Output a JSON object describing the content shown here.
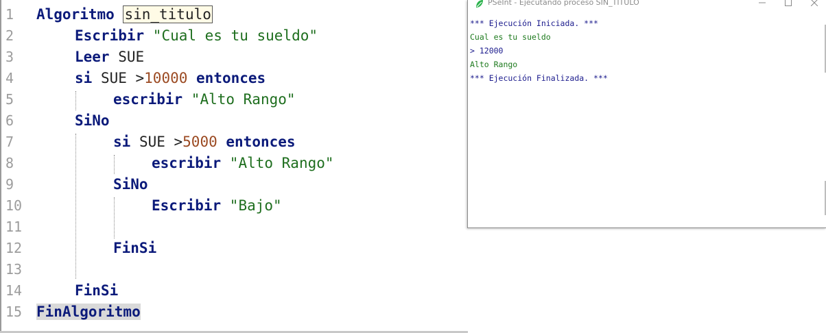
{
  "editor": {
    "lines": [
      {
        "num": "1",
        "tokens": [
          {
            "t": "Algoritmo",
            "c": "kw"
          },
          {
            "t": " ",
            "c": "idf"
          },
          {
            "t": "sin_titulo",
            "c": "box"
          }
        ]
      },
      {
        "num": "2",
        "tokens": [
          {
            "t": "Escribir",
            "c": "kw"
          },
          {
            "t": " \"Cual es tu sueldo\"",
            "c": "str"
          }
        ]
      },
      {
        "num": "3",
        "tokens": [
          {
            "t": "Leer",
            "c": "kw"
          },
          {
            "t": " SUE",
            "c": "idf"
          }
        ]
      },
      {
        "num": "4",
        "tokens": [
          {
            "t": "si",
            "c": "kw"
          },
          {
            "t": " SUE >",
            "c": "idf"
          },
          {
            "t": "10000",
            "c": "num"
          },
          {
            "t": " ",
            "c": "idf"
          },
          {
            "t": "entonces",
            "c": "kw"
          }
        ]
      },
      {
        "num": "5",
        "tokens": [
          {
            "t": "escribir",
            "c": "kw"
          },
          {
            "t": " \"Alto Rango\"",
            "c": "str"
          }
        ]
      },
      {
        "num": "6",
        "tokens": [
          {
            "t": "SiNo",
            "c": "kw"
          }
        ]
      },
      {
        "num": "7",
        "tokens": [
          {
            "t": "si",
            "c": "kw"
          },
          {
            "t": " SUE >",
            "c": "idf"
          },
          {
            "t": "5000",
            "c": "num"
          },
          {
            "t": " ",
            "c": "idf"
          },
          {
            "t": "entonces",
            "c": "kw"
          }
        ]
      },
      {
        "num": "8",
        "tokens": [
          {
            "t": "escribir",
            "c": "kw"
          },
          {
            "t": " \"Alto Rango\"",
            "c": "str"
          }
        ]
      },
      {
        "num": "9",
        "tokens": [
          {
            "t": "SiNo",
            "c": "kw"
          }
        ]
      },
      {
        "num": "10",
        "tokens": [
          {
            "t": "Escribir",
            "c": "kw"
          },
          {
            "t": " \"Bajo\"",
            "c": "str"
          }
        ]
      },
      {
        "num": "11",
        "tokens": []
      },
      {
        "num": "12",
        "tokens": [
          {
            "t": "FinSi",
            "c": "kw"
          }
        ]
      },
      {
        "num": "13",
        "tokens": []
      },
      {
        "num": "14",
        "tokens": [
          {
            "t": "FinSi",
            "c": "kw"
          }
        ]
      },
      {
        "num": "15",
        "tokens": [
          {
            "t": "FinAlgoritmo",
            "c": "sel"
          }
        ]
      }
    ]
  },
  "console": {
    "title": "PSeInt - Ejecutando proceso SIN_TITULO",
    "icon": "pseint-leaf-icon",
    "output": [
      {
        "text": "*** Ejecución Iniciada. ***",
        "style": "blue"
      },
      {
        "text": "Cual es tu sueldo",
        "style": "green"
      },
      {
        "text": "> 12000",
        "style": "dark"
      },
      {
        "text": "Alto Rango",
        "style": "green"
      },
      {
        "text": "*** Ejecución Finalizada. ***",
        "style": "blue"
      }
    ]
  },
  "colors": {
    "keyword": "#0b1a7a",
    "string": "#1e6e1e",
    "number": "#9b4a22",
    "line_number": "#9c9c9c",
    "console_blue": "#1a1a8c",
    "console_green": "#1e7a1e"
  }
}
